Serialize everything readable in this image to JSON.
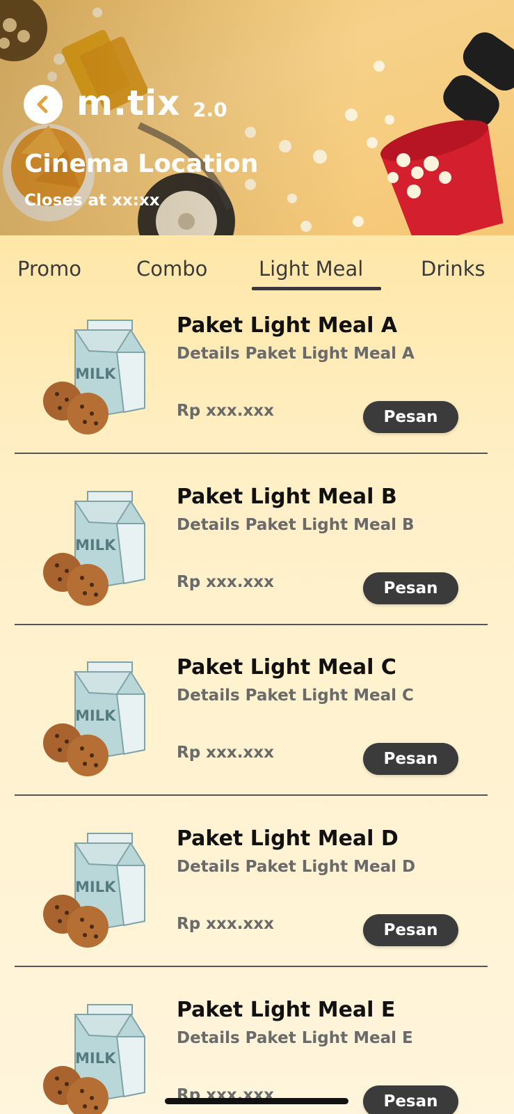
{
  "header": {
    "back_icon": "chevron-left-icon",
    "logo": "m.tix",
    "logo_version": "2.0",
    "cinema_location": "Cinema Location",
    "closes_at": "Closes at xx:xx"
  },
  "tabs": [
    {
      "label": "Promo",
      "active": false
    },
    {
      "label": "Combo",
      "active": false
    },
    {
      "label": "Light Meal",
      "active": true
    },
    {
      "label": "Drinks",
      "active": false
    }
  ],
  "items": [
    {
      "name": "Paket Light Meal A",
      "detail": "Details Paket Light Meal A",
      "price": "Rp xxx.xxx",
      "button": "Pesan"
    },
    {
      "name": "Paket Light Meal B",
      "detail": "Details Paket Light Meal B",
      "price": "Rp xxx.xxx",
      "button": "Pesan"
    },
    {
      "name": "Paket Light Meal C",
      "detail": "Details Paket Light Meal C",
      "price": "Rp xxx.xxx",
      "button": "Pesan"
    },
    {
      "name": "Paket Light Meal D",
      "detail": "Details Paket Light Meal D",
      "price": "Rp xxx.xxx",
      "button": "Pesan"
    },
    {
      "name": "Paket Light Meal E",
      "detail": "Details Paket Light Meal E",
      "price": "Rp xxx.xxx",
      "button": "Pesan"
    }
  ],
  "colors": {
    "accent": "#ffd46a",
    "button": "#3b3b3b",
    "text_dark": "#111111",
    "text_muted": "#6a6a6a"
  }
}
